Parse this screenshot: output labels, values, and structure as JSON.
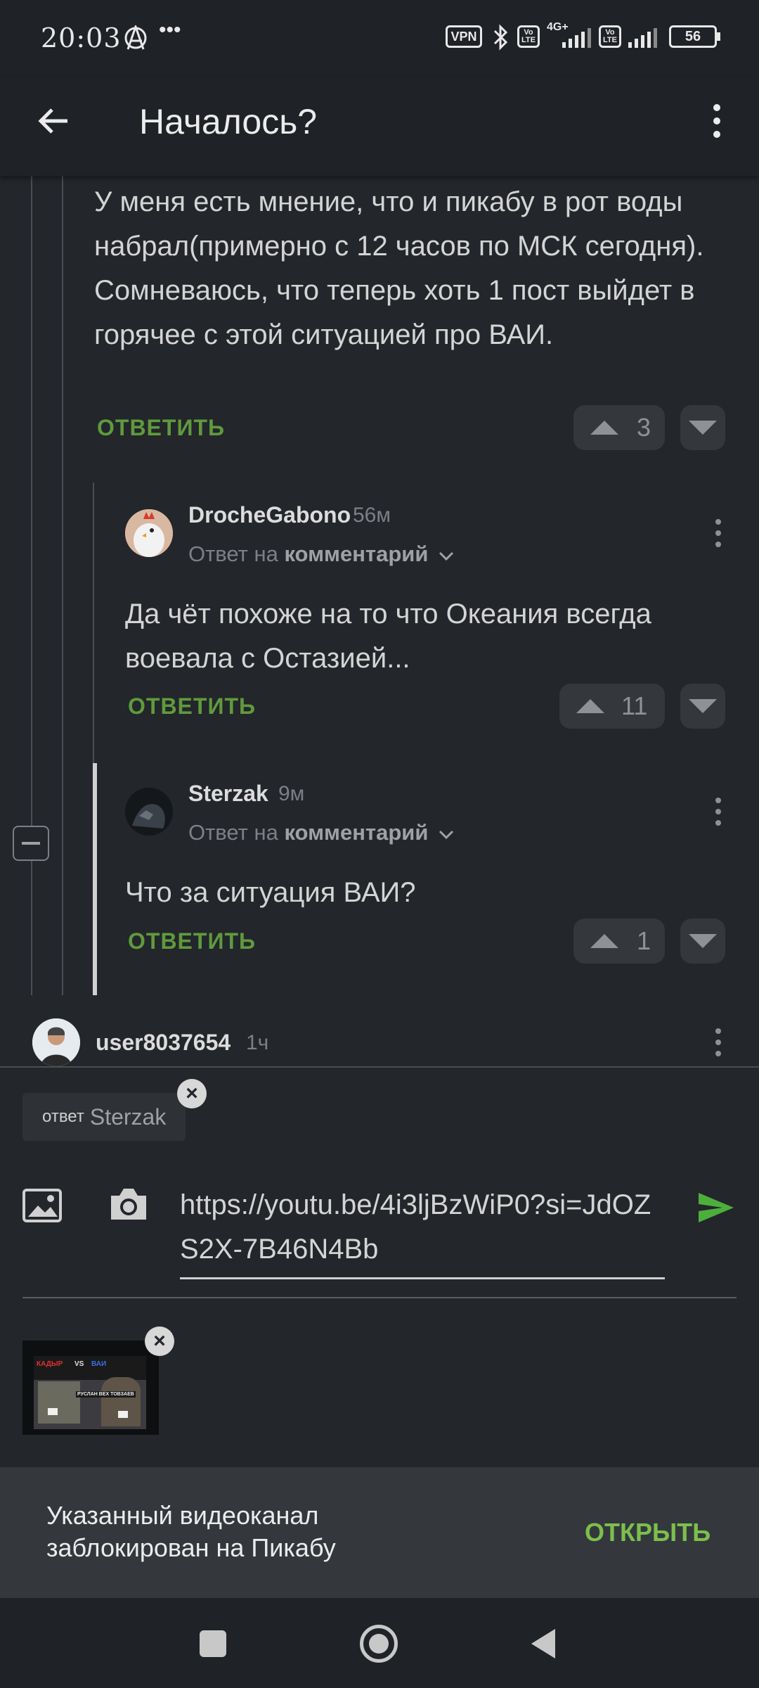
{
  "status_bar": {
    "time": "20:03",
    "vpn": "VPN",
    "volte": "Vo LTE",
    "net": "4G+",
    "battery": "56"
  },
  "app_bar": {
    "title": "Началось?"
  },
  "comments": {
    "c0": {
      "text": "У меня есть мнение, что и пикабу в рот воды набрал(примерно с 12 часов по МСК сегодня). Сомневаюсь, что теперь хоть 1 пост выйдет в горячее с этой ситуацией про ВАИ.",
      "reply": "ОТВЕТИТЬ",
      "votes": "3"
    },
    "c1": {
      "user": "DrocheGabono",
      "time": "56м",
      "reply_to_prefix": "Ответ на",
      "reply_to_target": "комментарий",
      "text": "Да чёт похоже на то что Океания всегда воевала с Остазией...",
      "reply": "ОТВЕТИТЬ",
      "votes": "11"
    },
    "c2": {
      "user": "Sterzak",
      "time": "9м",
      "reply_to_prefix": "Ответ на",
      "reply_to_target": "комментарий",
      "text": "Что за ситуация ВАИ?",
      "reply": "ОТВЕТИТЬ",
      "votes": "1"
    },
    "c3": {
      "user": "user8037654",
      "time": "1ч"
    }
  },
  "composer": {
    "reply_label": "ответ",
    "reply_user": "Sterzak",
    "input_value": "https://youtu.be/4i3ljBzWiP0?si=JdOZS2X-7B46N4Bb"
  },
  "thumbnail": {
    "title_left": "КАДЫР",
    "title_vs": "VS",
    "title_right": "ВАИ",
    "caption": "РУСЛАН ВЕХ ТОВЗАЕВ"
  },
  "banner": {
    "message": "Указанный видеоканал заблокирован на Пикабу",
    "action": "ОТКРЫТЬ"
  },
  "colors": {
    "background": "#23262a",
    "accent_green": "#5f9a3e",
    "send_green": "#4caf3c",
    "banner_bg": "#34383d"
  }
}
